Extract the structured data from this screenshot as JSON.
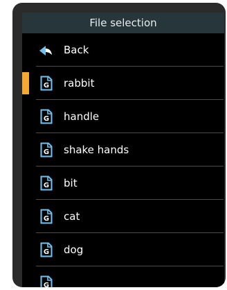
{
  "title": "File selection",
  "back_label": "Back",
  "files": [
    {
      "name": "rabbit",
      "selected": true
    },
    {
      "name": "handle",
      "selected": false
    },
    {
      "name": "shake hands",
      "selected": false
    },
    {
      "name": "bit",
      "selected": false
    },
    {
      "name": "cat",
      "selected": false
    },
    {
      "name": "dog",
      "selected": false
    },
    {
      "name": "",
      "selected": false
    }
  ],
  "colors": {
    "title_bar": "#27363a",
    "background": "#000000",
    "selection_accent": "#f3a934",
    "file_icon": "#6ec3f5",
    "back_icon": "#6ec3f5"
  },
  "icons": {
    "back": "back-arrow-icon",
    "file": "file-icon"
  }
}
